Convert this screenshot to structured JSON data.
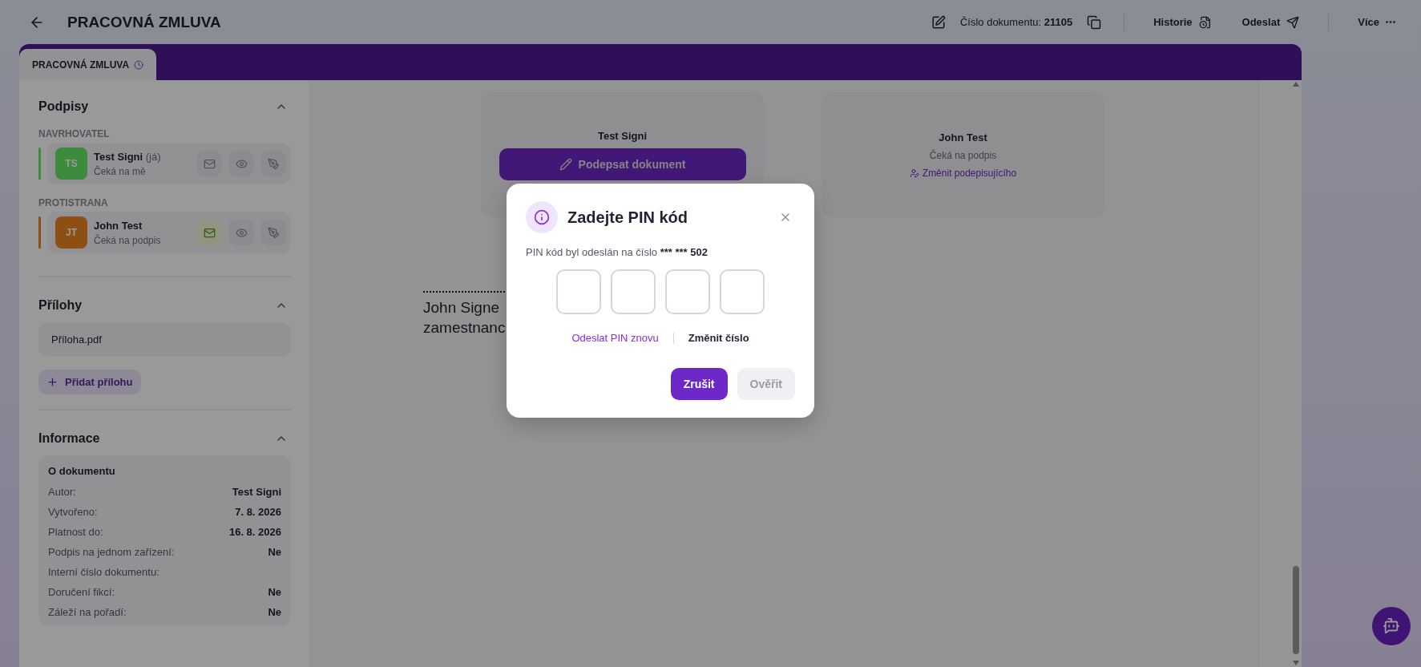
{
  "header": {
    "title": "PRACOVNÁ ZMLUVA",
    "doc_number_label": "Číslo dokumentu:",
    "doc_number": "21105",
    "actions": [
      {
        "kind": "history",
        "label": "Historie"
      },
      {
        "kind": "send",
        "label": "Odeslat"
      },
      {
        "kind": "more",
        "label": "Více"
      }
    ]
  },
  "tabs": [
    {
      "label": "PRACOVNÁ ZMLUVA",
      "selected": true
    }
  ],
  "sidebar": {
    "signatures": {
      "title": "Podpisy",
      "expanded": true,
      "groups": [
        {
          "label": "NAVRHOVATEL",
          "signers": [
            {
              "initials": "TS",
              "name": "Test Signi",
              "suffix": "(já)",
              "status": "Čeká na mě",
              "color": "#3e8b3e",
              "email_sent": false
            }
          ]
        },
        {
          "label": "PROTISTRANA",
          "signers": [
            {
              "initials": "JT",
              "name": "John Test",
              "status": "Čeká na podpis",
              "color": "#8c5015",
              "email_sent": true
            }
          ]
        }
      ]
    },
    "attachments": {
      "title": "Přílohy",
      "expanded": true,
      "files": [
        "Příloha.pdf"
      ],
      "add_label": "Přidat přílohu"
    },
    "info": {
      "title": "Informace",
      "expanded": true,
      "card_title": "O dokumentu",
      "rows": [
        {
          "label": "Autor:",
          "value": "Test Signi"
        },
        {
          "label": "Vytvořeno:",
          "value": "7. 8. 2026"
        },
        {
          "label": "Platnost do:",
          "value": "16. 8. 2026"
        },
        {
          "label": "Podpis na jednom zařízení:",
          "value": "Ne"
        },
        {
          "label": "Interní číslo dokumentu:"
        },
        {
          "label": "Doručení fikcí:",
          "value": "Ne"
        },
        {
          "label": "Záleží na pořadí:",
          "value": "Ne"
        }
      ]
    }
  },
  "document": {
    "signer_cards": [
      {
        "kind": "sign",
        "name": "Test Signi",
        "button": "Podepsat dokument"
      },
      {
        "kind": "pending",
        "name": "John Test",
        "status": "Čeká na podpis",
        "link": "Změnit podepisujícího"
      }
    ],
    "body_lines": [
      "John Signe",
      "zamestnanc"
    ]
  },
  "modal": {
    "title": "Zadejte PIN kód",
    "message": "PIN kód byl odeslán na číslo",
    "phone": "*** *** 502",
    "pin_fields": [
      {
        "filled": false
      },
      {
        "filled": false
      },
      {
        "filled": false
      },
      {
        "filled": false
      }
    ],
    "resend_link": "Odeslat PIN znovu",
    "change_link": "Změnit číslo",
    "buttons": [
      {
        "label": "Zrušit",
        "kind": "primary",
        "disabled": false
      },
      {
        "label": "Ověřit",
        "kind": "secondary",
        "disabled": true
      }
    ]
  }
}
